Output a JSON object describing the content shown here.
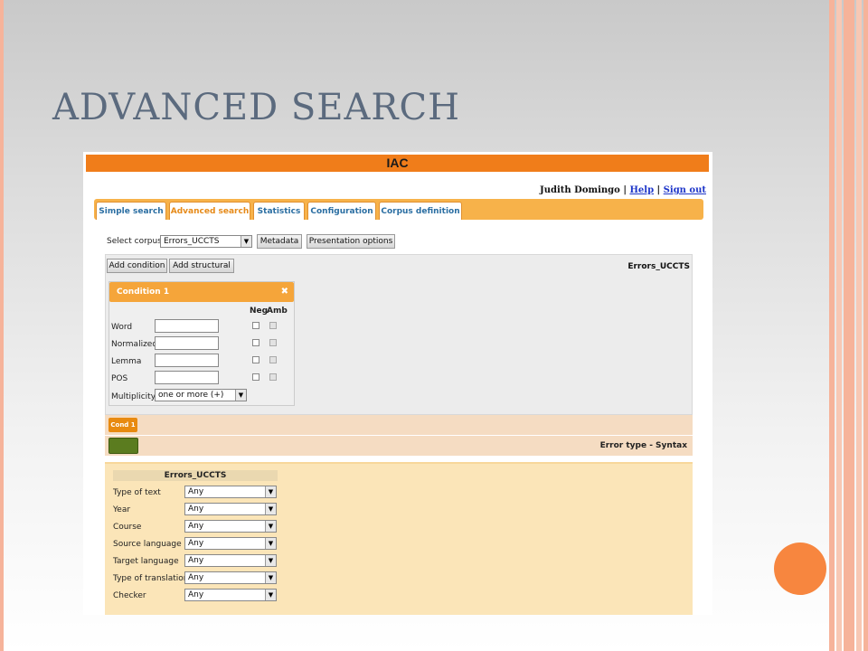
{
  "slide": {
    "title": "ADVANCED SEARCH"
  },
  "app": {
    "title": "IAC",
    "user": {
      "name": "Judith Domingo",
      "separator": "|",
      "help": "Help",
      "signout": "Sign out"
    },
    "tabs": [
      {
        "label": "Simple search"
      },
      {
        "label": "Advanced search",
        "active": true
      },
      {
        "label": "Statistics"
      },
      {
        "label": "Configuration"
      },
      {
        "label": "Corpus definition"
      }
    ],
    "corpus": {
      "label": "Select corpus:",
      "value": "Errors_UCCTS",
      "metadata_btn": "Metadata",
      "presentation_btn": "Presentation options"
    },
    "query": {
      "add_condition": "Add condition",
      "add_structural": "Add structural",
      "corpus_name": "Errors_UCCTS"
    },
    "condition": {
      "title": "Condition 1",
      "close": "✖",
      "neg": "Neg",
      "amb": "Amb",
      "fields": [
        "Word",
        "Normalized",
        "Lemma",
        "POS"
      ],
      "multiplicity_label": "Multiplicity",
      "multiplicity_value": "one or more (+)"
    },
    "cond_chip": "Cond 1",
    "error_type": "Error type - Syntax",
    "metadata": {
      "title": "Errors_UCCTS",
      "rows": [
        {
          "label": "Type of text",
          "value": "Any"
        },
        {
          "label": "Year",
          "value": "Any"
        },
        {
          "label": "Course",
          "value": "Any"
        },
        {
          "label": "Source language",
          "value": "Any"
        },
        {
          "label": "Target language",
          "value": "Any"
        },
        {
          "label": "Type of translation",
          "value": "Any"
        },
        {
          "label": "Checker",
          "value": "Any"
        }
      ]
    }
  }
}
